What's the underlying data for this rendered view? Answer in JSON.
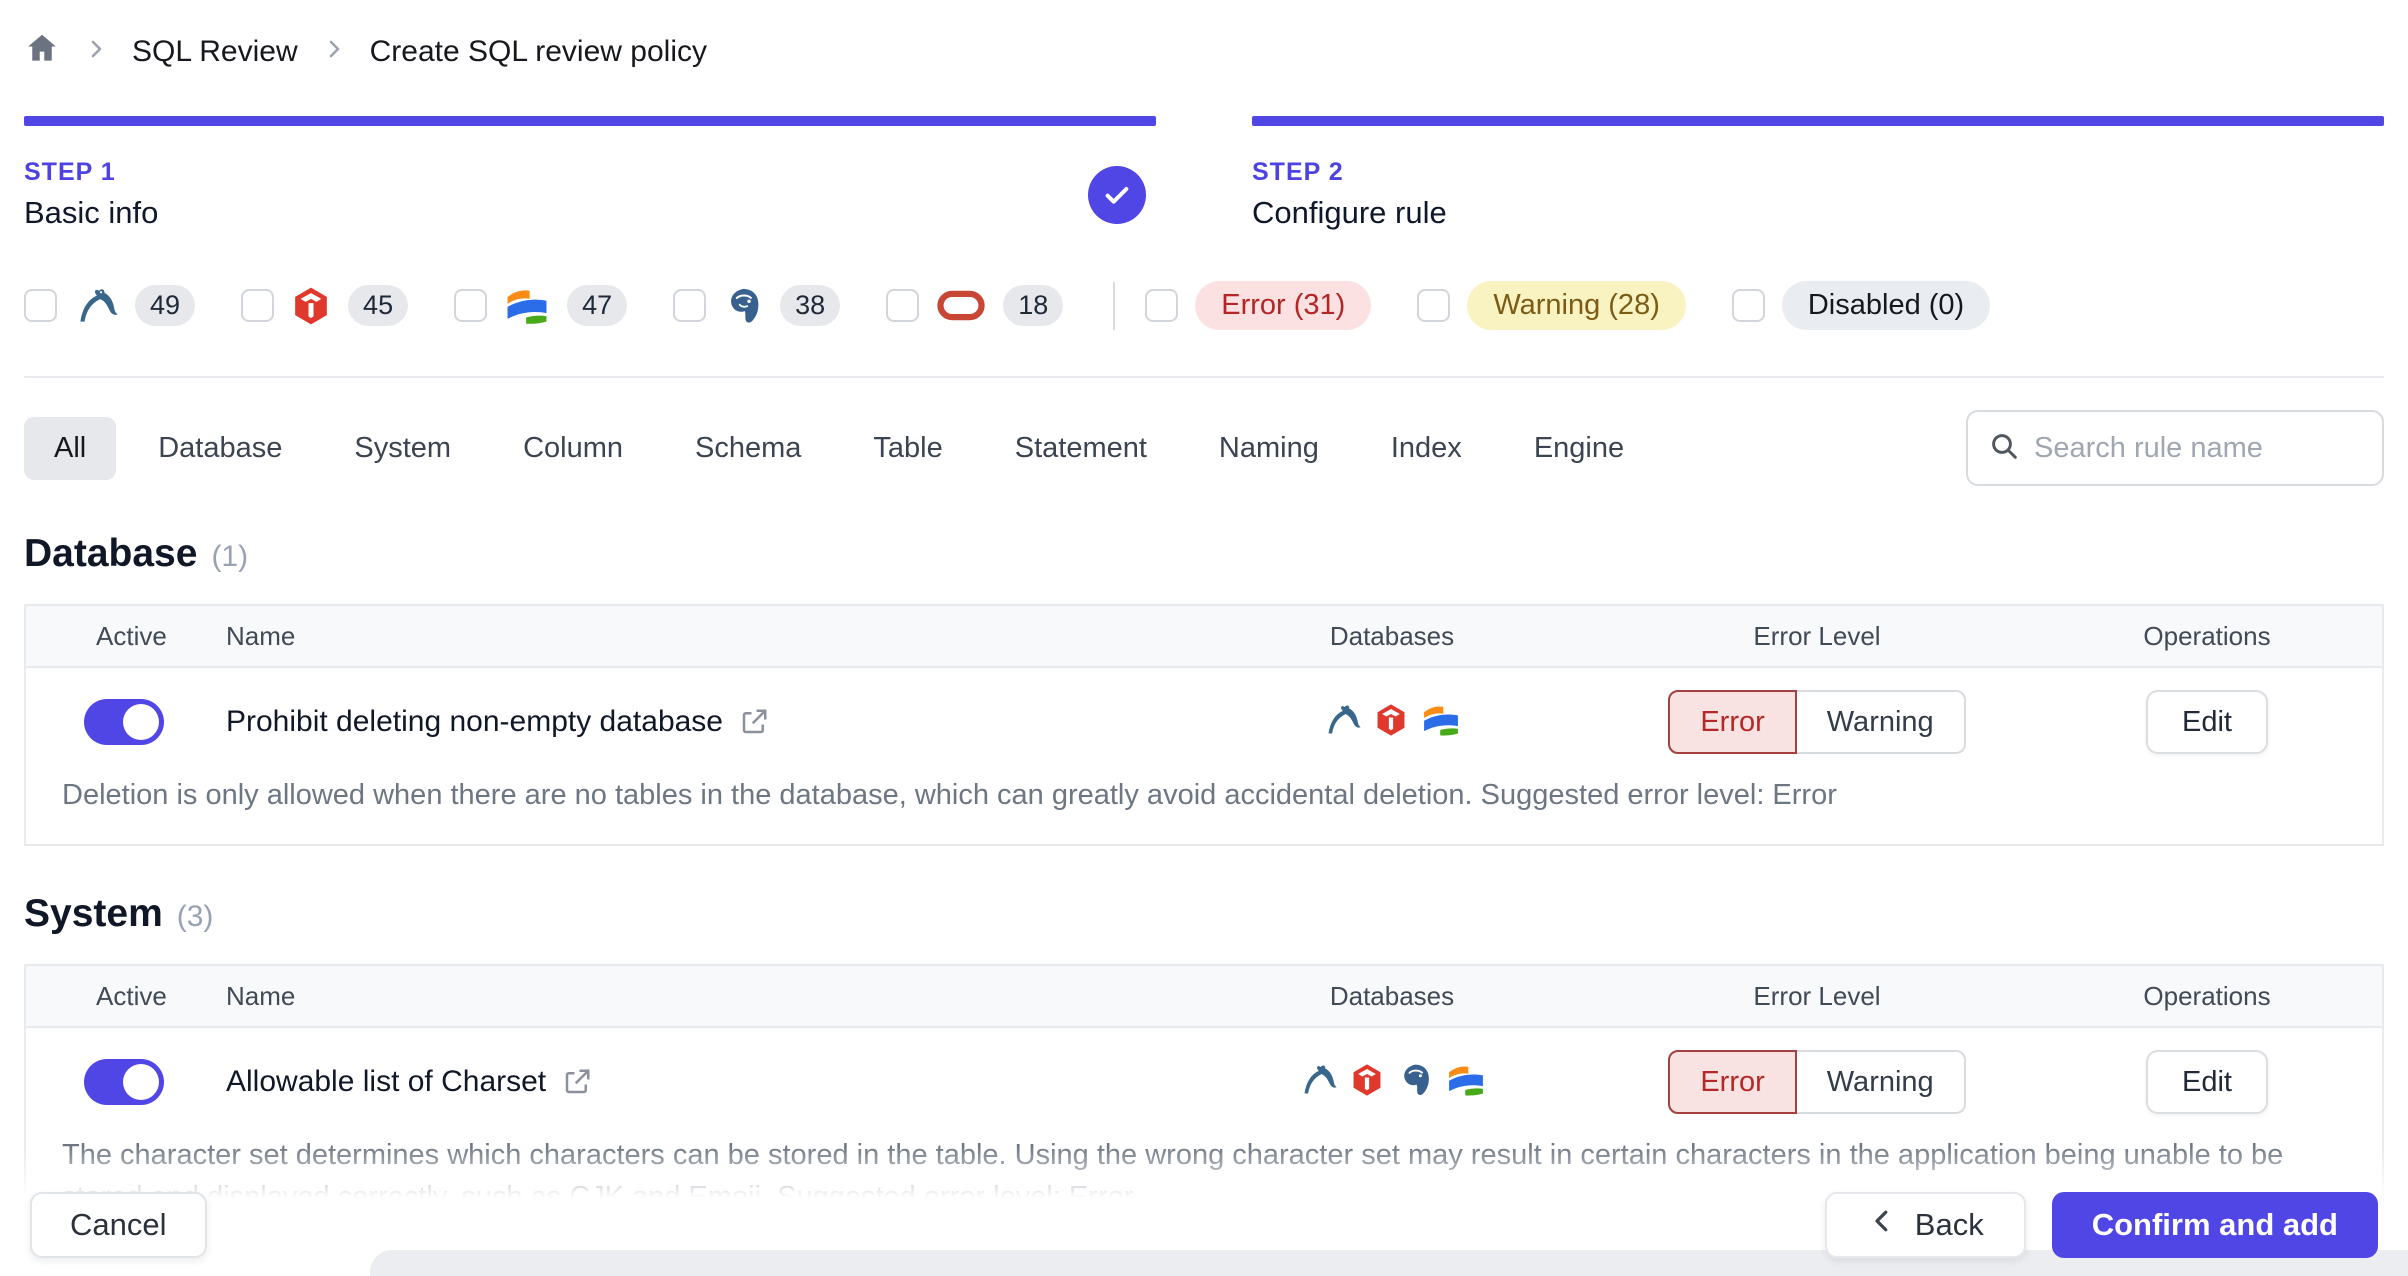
{
  "breadcrumb": {
    "items": [
      {
        "label": "SQL Review"
      },
      {
        "label": "Create SQL review policy"
      }
    ]
  },
  "steps": [
    {
      "label": "STEP 1",
      "title": "Basic info",
      "status": "completed"
    },
    {
      "label": "STEP 2",
      "title": "Configure rule",
      "status": "current"
    }
  ],
  "filters": {
    "engines": [
      {
        "name": "MySQL",
        "icon": "mysql-icon",
        "count": "49",
        "checked": false
      },
      {
        "name": "TiDB",
        "icon": "tidb-icon",
        "count": "45",
        "checked": false
      },
      {
        "name": "OceanBase",
        "icon": "oceanbase-icon",
        "count": "47",
        "checked": false
      },
      {
        "name": "PostgreSQL",
        "icon": "postgresql-icon",
        "count": "38",
        "checked": false
      },
      {
        "name": "Oracle",
        "icon": "oracle-icon",
        "count": "18",
        "checked": false
      }
    ],
    "levels": [
      {
        "label": "Error (31)",
        "type": "error",
        "checked": false
      },
      {
        "label": "Warning (28)",
        "type": "warning",
        "checked": false
      },
      {
        "label": "Disabled (0)",
        "type": "disabled",
        "checked": false
      }
    ]
  },
  "tabs": {
    "selected": "All",
    "items": [
      {
        "label": "All"
      },
      {
        "label": "Database"
      },
      {
        "label": "System"
      },
      {
        "label": "Column"
      },
      {
        "label": "Schema"
      },
      {
        "label": "Table"
      },
      {
        "label": "Statement"
      },
      {
        "label": "Naming"
      },
      {
        "label": "Index"
      },
      {
        "label": "Engine"
      }
    ]
  },
  "search": {
    "placeholder": "Search rule name",
    "value": ""
  },
  "table_columns": {
    "active": "Active",
    "name": "Name",
    "databases": "Databases",
    "error_level": "Error Level",
    "operations": "Operations"
  },
  "sections": [
    {
      "title": "Database",
      "count": "(1)",
      "rows": [
        {
          "active": true,
          "name": "Prohibit deleting non-empty database",
          "databases": [
            "MySQL",
            "TiDB",
            "OceanBase"
          ],
          "error_level_selected": "Error",
          "error_level_options": {
            "error": "Error",
            "warning": "Warning"
          },
          "operation": "Edit",
          "description": "Deletion is only allowed when there are no tables in the database, which can greatly avoid accidental deletion. Suggested error level: Error"
        }
      ]
    },
    {
      "title": "System",
      "count": "(3)",
      "rows": [
        {
          "active": true,
          "name": "Allowable list of Charset",
          "databases": [
            "MySQL",
            "TiDB",
            "PostgreSQL",
            "OceanBase"
          ],
          "error_level_selected": "Error",
          "error_level_options": {
            "error": "Error",
            "warning": "Warning"
          },
          "operation": "Edit",
          "description": "The character set determines which characters can be stored in the table. Using the wrong character set may result in certain characters in the application being unable to be stored and displayed correctly, such as CJK and Emoji. Suggested error level: Error"
        }
      ]
    }
  ],
  "footer": {
    "cancel_label": "Cancel",
    "back_label": "Back",
    "confirm_label": "Confirm and add"
  },
  "colors": {
    "accent": "#4f46e5",
    "error_text": "#b42828",
    "error_bg": "#f9e2e2",
    "warning_filter_bg": "#f9f3c2",
    "warning_filter_text": "#7c5c14",
    "disabled_bg": "#e9edf1",
    "border": "#e8eaed"
  }
}
